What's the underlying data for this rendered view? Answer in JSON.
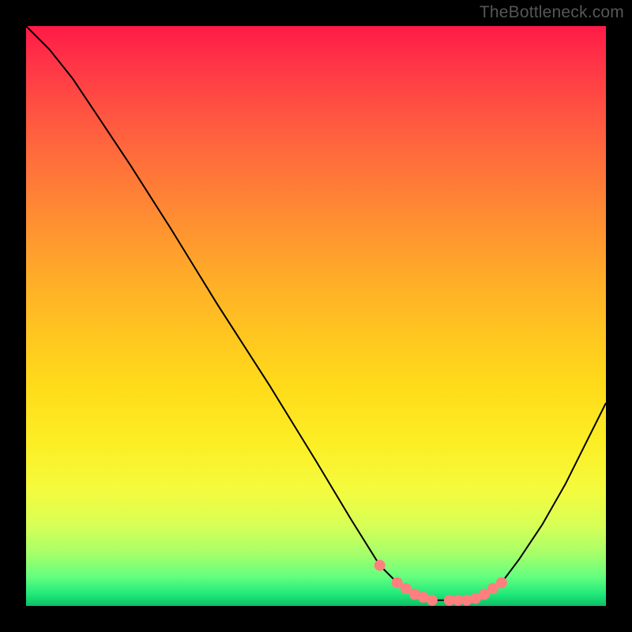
{
  "watermark": "TheBottleneck.com",
  "chart_data": {
    "type": "line",
    "title": "",
    "xlabel": "",
    "ylabel": "",
    "xlim": [
      0,
      100
    ],
    "ylim": [
      0,
      100
    ],
    "curve": {
      "x": [
        0,
        4,
        8,
        12,
        18,
        25,
        33,
        42,
        50,
        56,
        61,
        64,
        67,
        70,
        73,
        76,
        79,
        82,
        85,
        89,
        93,
        97,
        100
      ],
      "y": [
        100,
        96,
        91,
        85,
        76,
        65,
        52,
        38,
        25,
        15,
        7,
        4,
        2,
        1,
        1,
        1,
        2,
        4,
        8,
        14,
        21,
        29,
        35
      ]
    },
    "dots": {
      "x": [
        61,
        64,
        65.5,
        67,
        68.5,
        70,
        73,
        74.5,
        76,
        77.5,
        79,
        80.5,
        82
      ],
      "y": [
        7,
        4,
        3,
        2,
        1.5,
        1,
        1,
        1,
        1,
        1.3,
        2,
        3,
        4
      ],
      "color": "#ff7f7f",
      "radius": 7
    },
    "stroke": "#000000",
    "stroke_width": 2
  }
}
